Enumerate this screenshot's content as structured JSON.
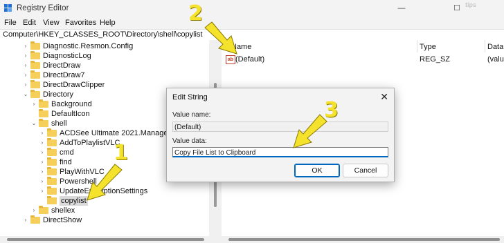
{
  "window": {
    "title": "Registry Editor",
    "watermark": "tips"
  },
  "menu": [
    "File",
    "Edit",
    "View",
    "Favorites",
    "Help"
  ],
  "address": "Computer\\HKEY_CLASSES_ROOT\\Directory\\shell\\copylist",
  "tree": [
    {
      "label": "Diagnostic.Resmon.Config",
      "chev": "›"
    },
    {
      "label": "DiagnosticLog",
      "chev": "›"
    },
    {
      "label": "DirectDraw",
      "chev": "›"
    },
    {
      "label": "DirectDraw7",
      "chev": "›"
    },
    {
      "label": "DirectDrawClipper",
      "chev": "›"
    },
    {
      "label": "Directory",
      "chev": "⌄"
    },
    {
      "label": "Background",
      "chev": "›"
    },
    {
      "label": "DefaultIcon",
      "chev": ""
    },
    {
      "label": "shell",
      "chev": "⌄"
    },
    {
      "label": "ACDSee Ultimate 2021.Manage",
      "chev": "›"
    },
    {
      "label": "AddToPlaylistVLC",
      "chev": "›"
    },
    {
      "label": "cmd",
      "chev": "›"
    },
    {
      "label": "find",
      "chev": "›"
    },
    {
      "label": "PlayWithVLC",
      "chev": "›"
    },
    {
      "label": "Powershell",
      "chev": "›"
    },
    {
      "label": "UpdateEncryptionSettings",
      "chev": "›"
    },
    {
      "label": "copylist",
      "chev": ""
    },
    {
      "label": "shellex",
      "chev": "›"
    },
    {
      "label": "DirectShow",
      "chev": "›"
    }
  ],
  "list": {
    "columns": [
      "Name",
      "Type",
      "Data"
    ],
    "row": {
      "name": "(Default)",
      "type": "REG_SZ",
      "data": "(value"
    }
  },
  "dialog": {
    "title": "Edit String",
    "value_name_label": "Value name:",
    "value_name": "(Default)",
    "value_data_label": "Value data:",
    "value_data": "Copy File List to Clipboard",
    "ok": "OK",
    "cancel": "Cancel"
  },
  "annotations": [
    "1",
    "2",
    "3"
  ],
  "colors": {
    "arrow": "#f4e22c",
    "selection": "#d9d9d9",
    "accent": "#0067c0"
  }
}
